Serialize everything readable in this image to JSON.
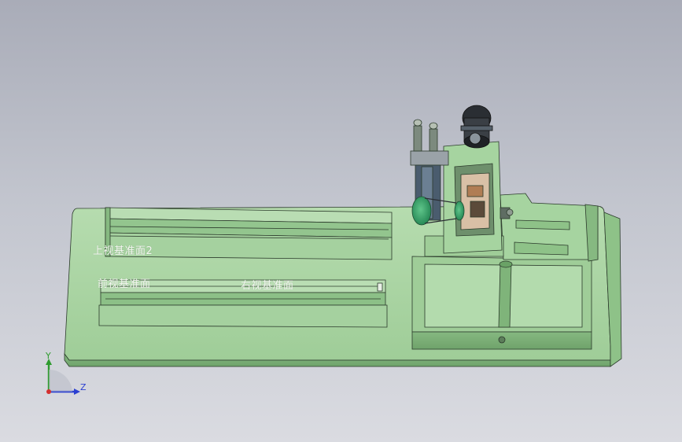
{
  "viewport": {
    "background_top": "#a9acb8",
    "background_bottom": "#dadbe1"
  },
  "colors": {
    "part_green": "#a6d4a0",
    "part_green_dark": "#7fb47a",
    "edge": "#2b3a2b",
    "pulley_green": "#3aa36a",
    "motor_dark": "#2a2e33",
    "axis_x": "#d32f2f",
    "axis_y": "#2e9b2e",
    "axis_z": "#2b3fd1"
  },
  "labels": {
    "plane_1": "上视基准面2",
    "plane_2": "前视基准面",
    "plane_3": "右视基准面"
  },
  "triad": {
    "y_label": "Y",
    "z_label": "Z"
  }
}
